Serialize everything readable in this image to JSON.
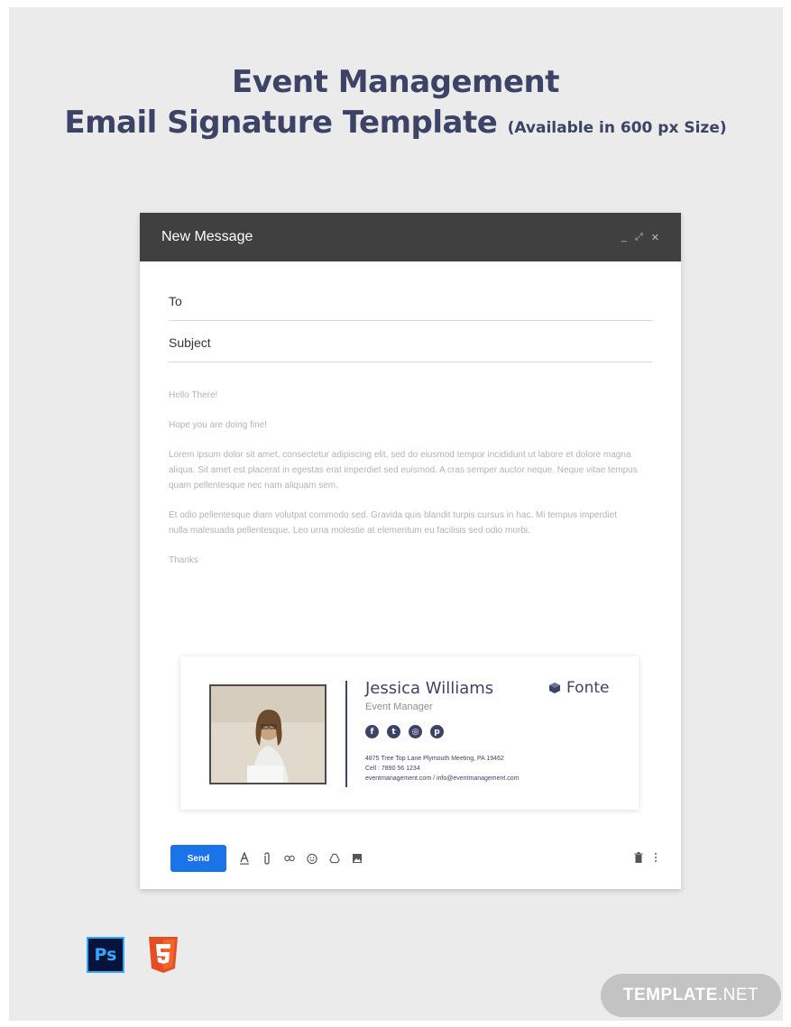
{
  "page": {
    "title_line1": "Event Management",
    "title_line2": "Email Signature Template",
    "title_note": "(Available in 600 px Size)"
  },
  "window": {
    "title": "New Message",
    "controls": {
      "minimize": "_",
      "expand": "⤢",
      "close": "✕"
    }
  },
  "compose": {
    "to_label": "To",
    "subject_label": "Subject",
    "body": [
      "Hello There!",
      "Hope you are doing fine!",
      "Lorem ipsum dolor sit amet, consectetur adipiscing elit, sed do eiusmod tempor incididunt ut labore et dolore magna aliqua. Sit amet est placerat in egestas erat imperdiet sed euismod. A cras semper auctor neque. Neque vitae tempus quam pellentesque nec nam aliquam sem.",
      "Et odio pellentesque diam volutpat commodo sed. Gravida quis blandit turpis cursus in hac. Mi tempus imperdiet nulla malesuada pellentesque. Leo urna molestie at elementum eu facilisis sed odio morbi.",
      "Thanks"
    ]
  },
  "signature": {
    "name": "Jessica Williams",
    "role": "Event Manager",
    "brand": "Fonte",
    "social_icons": [
      "facebook-icon",
      "twitter-icon",
      "instagram-icon",
      "pinterest-icon"
    ],
    "address": "4875 Tree Top Lane Plymouth Meeting, PA 19462",
    "cell": "Cell : 7890 56 1234",
    "web": "eventmanagement.com / info@eventmanagement.com"
  },
  "toolbar": {
    "send_label": "Send",
    "tools": [
      "text-format-icon",
      "attach-icon",
      "link-icon",
      "emoji-icon",
      "drive-icon",
      "photo-icon"
    ],
    "right_tools": [
      "trash-icon",
      "more-options-icon"
    ]
  },
  "footer": {
    "ps_label": "Ps",
    "brand_main": "TEMPLATE",
    "brand_suffix": ".NET"
  },
  "colors": {
    "accent": "#3d4366",
    "titlebar": "#404040",
    "send": "#1a73e8",
    "html5": "#e44d26"
  }
}
